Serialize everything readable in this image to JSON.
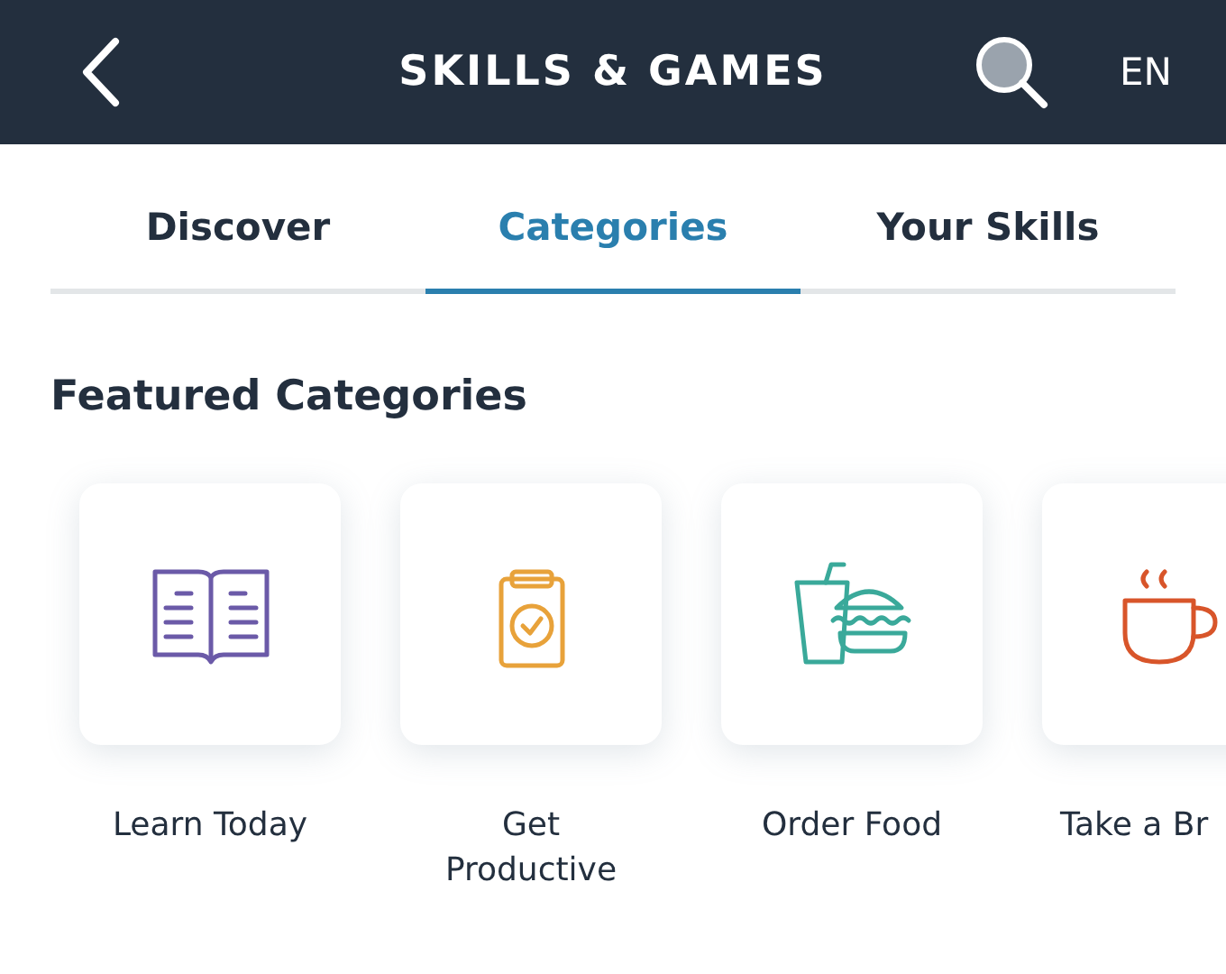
{
  "header": {
    "title": "SKILLS & GAMES",
    "language": "EN"
  },
  "tabs": [
    {
      "label": "Discover",
      "selected": false
    },
    {
      "label": "Categories",
      "selected": true
    },
    {
      "label": "Your Skills",
      "selected": false
    }
  ],
  "section": {
    "title": "Featured Categories"
  },
  "categories": [
    {
      "label": "Learn Today",
      "color": "#6b5aa8",
      "partial": false
    },
    {
      "label": "Get Productive",
      "color": "#e8a23a",
      "partial": false
    },
    {
      "label": "Order Food",
      "color": "#3aa99a",
      "partial": false
    },
    {
      "label": "Take a Br",
      "color": "#d8552a",
      "partial": true
    }
  ]
}
